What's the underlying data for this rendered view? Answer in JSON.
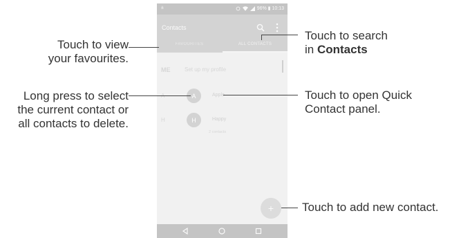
{
  "phone": {
    "status_bar": {
      "left": "±",
      "right": "96% ▮ 10:13"
    },
    "app_title": "Contacts",
    "tabs": [
      "FAVOURITES",
      "ALL CONTACTS"
    ],
    "me_label": "ME",
    "profile_text": "Set up my profile",
    "contacts": [
      {
        "letter": "A",
        "initial": "A",
        "name": "Apple"
      },
      {
        "letter": "H",
        "initial": "H",
        "name": "Happy"
      }
    ],
    "contact_count": "2 contacts",
    "fab_label": "+",
    "nav": [
      "back",
      "home",
      "recents"
    ]
  },
  "callouts": {
    "favourites": [
      "Touch to view",
      "your favourites."
    ],
    "delete": [
      "Long press to select",
      "the current contact or",
      "all contacts to delete."
    ],
    "search_line1": "Touch to search",
    "search_line2_prefix": "in ",
    "search_line2_bold": "Contacts",
    "quick_contact": [
      "Touch to open Quick",
      "Contact panel."
    ],
    "add_contact": "Touch to add new contact."
  },
  "colors": {
    "appbar": "#d3d3d3",
    "statusbar": "#c4c4c4",
    "background": "#f1f1f1",
    "text": "#333333"
  }
}
